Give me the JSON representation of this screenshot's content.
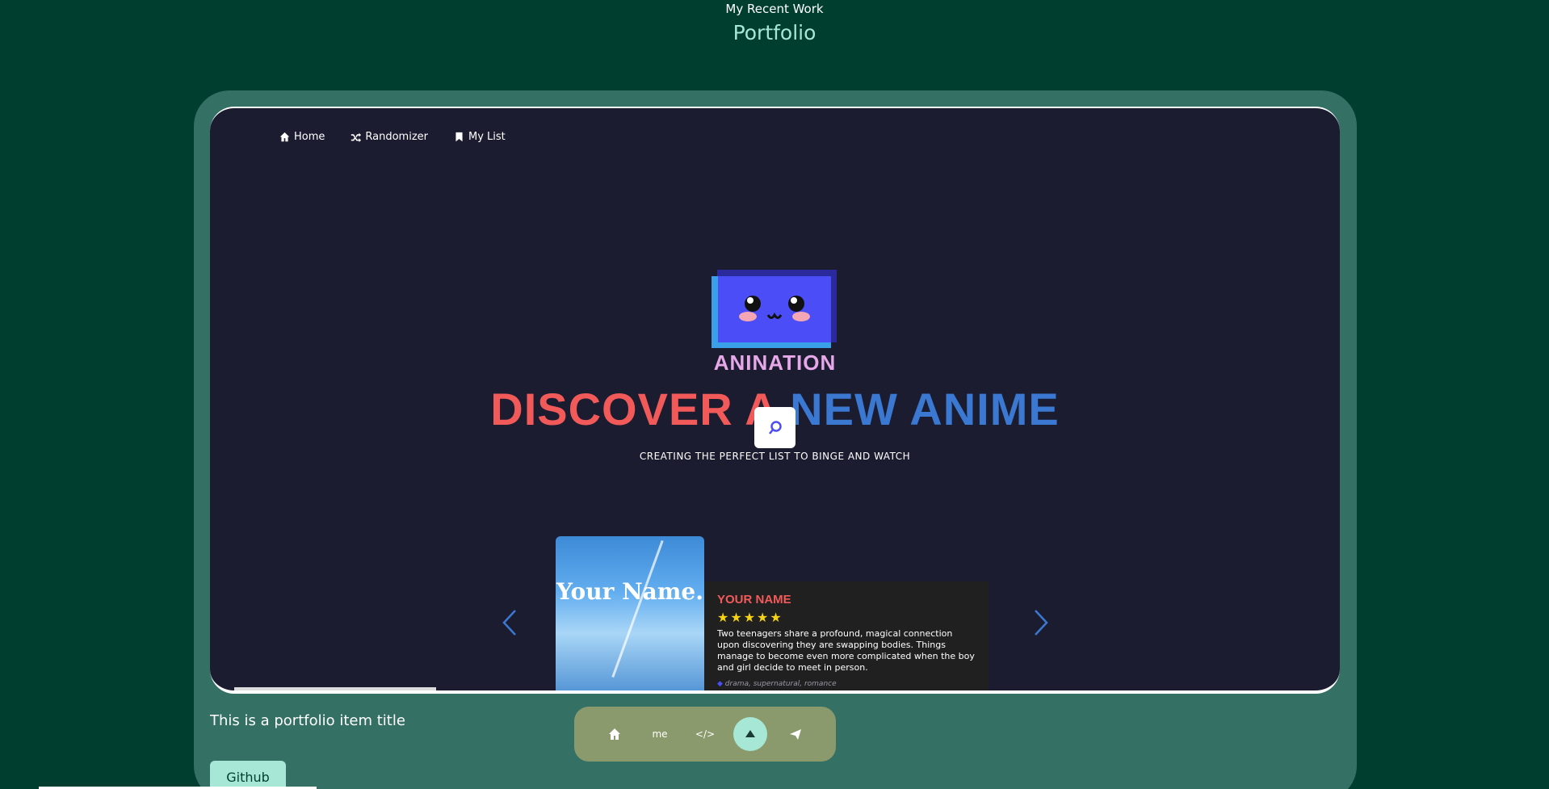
{
  "section": {
    "subtitle": "My Recent Work",
    "title": "Portfolio"
  },
  "app_nav": {
    "items": [
      {
        "label": "Home",
        "icon": "home-icon"
      },
      {
        "label": "Randomizer",
        "icon": "shuffle-icon"
      },
      {
        "label": "My List",
        "icon": "bookmark-icon"
      }
    ]
  },
  "hero": {
    "brand": "ANINATION",
    "headline_red": "DISCOVER A",
    "headline_blue": "NEW ANIME",
    "tagline": "CREATING THE PERFECT LIST TO BINGE AND WATCH",
    "search_icon": "search-icon"
  },
  "featured": {
    "poster_title": "Your Name.",
    "title": "YOUR NAME",
    "stars": "★★★★★",
    "description": "Two teenagers share a profound, magical connection upon discovering they are swapping bodies. Things manage to become even more complicated when the boy and girl decide to meet in person.",
    "tags": "drama, supernatural, romance"
  },
  "portfolio_item": {
    "title": "This is a portfolio item title",
    "github_label": "Github"
  },
  "dock": {
    "items": [
      "home-icon",
      "me",
      "</>",
      "server-icon",
      "send-icon"
    ]
  },
  "colors": {
    "page_bg": "#003f30",
    "card_bg": "#347063",
    "accent": "#a6e7d6",
    "red": "#f25a5a",
    "blue": "#3a78d2",
    "dock_bg": "#8b9a6d"
  }
}
